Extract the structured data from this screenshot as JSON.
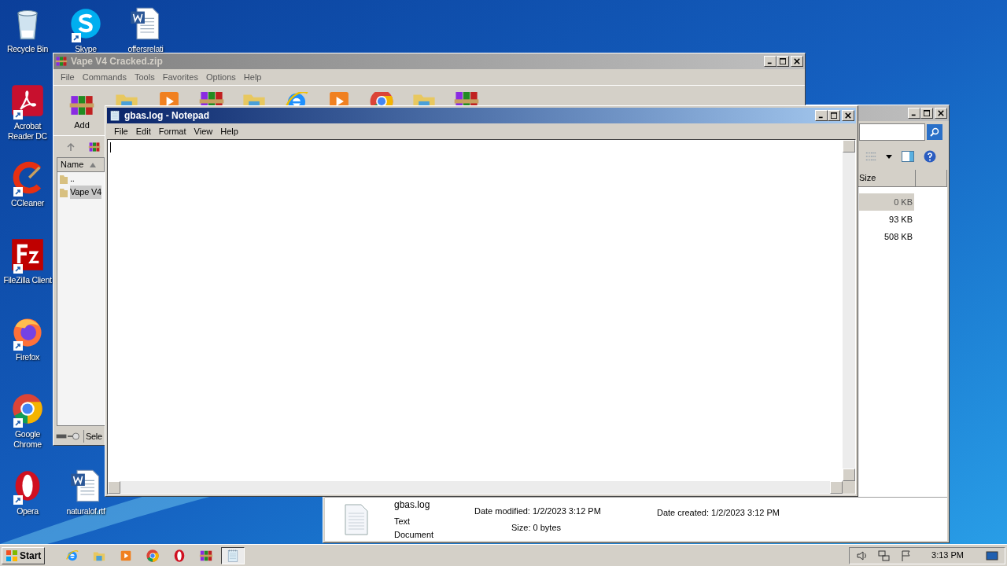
{
  "desktop_icons": [
    {
      "label": "Recycle Bin",
      "kind": "recycle"
    },
    {
      "label": "Skype",
      "kind": "skype"
    },
    {
      "label": "offersrelati",
      "kind": "word"
    },
    {
      "label": "Acrobat Reader DC",
      "kind": "acrobat"
    },
    {
      "label": "CCleaner",
      "kind": "ccleaner"
    },
    {
      "label": "FileZilla Client",
      "kind": "filezilla"
    },
    {
      "label": "Firefox",
      "kind": "firefox"
    },
    {
      "label": "Google Chrome",
      "kind": "chrome"
    },
    {
      "label": "Opera",
      "kind": "opera"
    },
    {
      "label": "naturalof.rtf",
      "kind": "word"
    }
  ],
  "explorer": {
    "active": false,
    "columns": [
      "Size"
    ],
    "rows": [
      {
        "size": "0 KB",
        "selected": true
      },
      {
        "size": "93 KB",
        "selected": false
      },
      {
        "size": "508 KB",
        "selected": false
      }
    ],
    "details": {
      "name": "gbas.log",
      "type": "Text Document",
      "modified_label": "Date modified:",
      "modified": "1/2/2023 3:12 PM",
      "created_label": "Date created:",
      "created": "1/2/2023 3:12 PM",
      "size_label": "Size:",
      "size": "0 bytes"
    }
  },
  "winrar": {
    "title": "Vape V4 Cracked.zip",
    "active": false,
    "menu": [
      "File",
      "Commands",
      "Tools",
      "Favorites",
      "Options",
      "Help"
    ],
    "toolbar": [
      {
        "label": "Add"
      }
    ],
    "columns": [
      "Name"
    ],
    "rows": [
      {
        "name": "..",
        "selected": false
      },
      {
        "name": "Vape V4",
        "selected": true
      }
    ],
    "status": "Sele"
  },
  "notepad": {
    "title": "gbas.log - Notepad",
    "active": true,
    "menu": [
      "File",
      "Edit",
      "Format",
      "View",
      "Help"
    ]
  },
  "taskbar": {
    "start": "Start",
    "apps": [
      {
        "kind": "ie",
        "selected": false
      },
      {
        "kind": "explorer",
        "selected": false
      },
      {
        "kind": "media",
        "selected": false
      },
      {
        "kind": "chrome",
        "selected": false
      },
      {
        "kind": "opera",
        "selected": false
      },
      {
        "kind": "winrar",
        "selected": false
      },
      {
        "kind": "notepad",
        "selected": true
      }
    ],
    "clock": "3:13 PM"
  }
}
